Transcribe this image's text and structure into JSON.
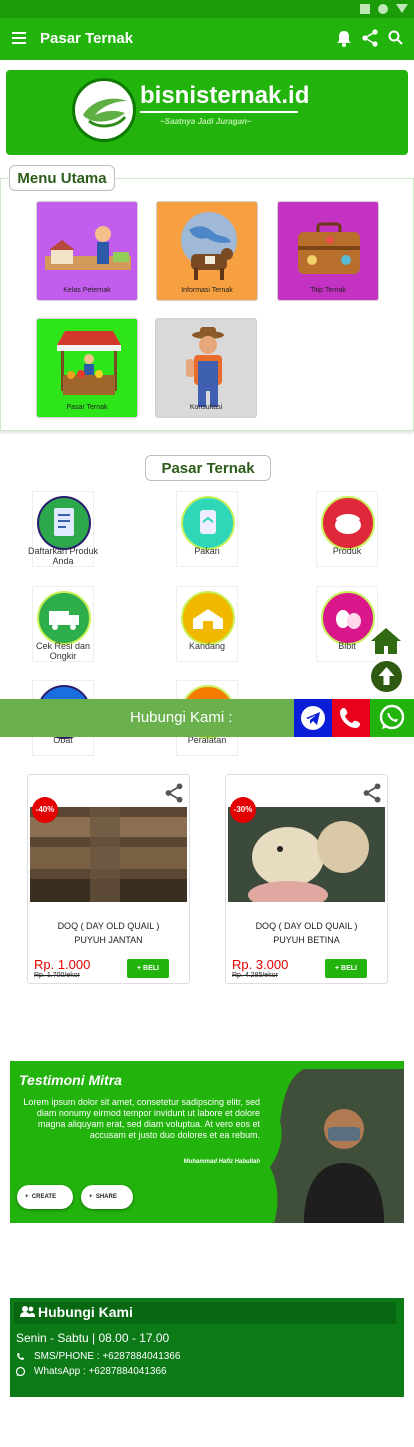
{
  "app": {
    "title": "Pasar Ternak"
  },
  "banner": {
    "brand": "bisnisternak.id",
    "tagline": "~Saatnya Jadi Juragan~"
  },
  "menu_utama": {
    "heading": "Menu Utama",
    "items": [
      {
        "label": "Kelas Peternak",
        "color": "#c35ded"
      },
      {
        "label": "Informasi Ternak",
        "color": "#f6a041"
      },
      {
        "label": "Titip Ternak",
        "color": "#c432c4"
      },
      {
        "label": "Pasar Ternak",
        "color": "#2ee51a"
      },
      {
        "label": "Konsultasi",
        "color": "#d9d9d9"
      }
    ]
  },
  "pasar_ternak": {
    "heading": "Pasar Ternak",
    "categories": [
      {
        "label": "Daftarkan Produk Anda",
        "color": "#2ea84d"
      },
      {
        "label": "Pakan",
        "color": "#2fd6b8"
      },
      {
        "label": "Produk",
        "color": "#e0283a"
      },
      {
        "label": "Cek Resi dan Ongkir",
        "color": "#2eae4a"
      },
      {
        "label": "Kandang",
        "color": "#f0b900"
      },
      {
        "label": "Bibit",
        "color": "#d9178a"
      },
      {
        "label": "Obat",
        "color": "#1a6fe0"
      },
      {
        "label": "Peralatan",
        "color": "#f57c00"
      }
    ]
  },
  "contact_bar": {
    "label": "Hubungi Kami :"
  },
  "products": [
    {
      "discount": "-40%",
      "name_line1": "DOQ ( DAY OLD QUAIL )",
      "name_line2": "PUYUH JANTAN",
      "price": "Rp. 1.000",
      "old_price": "Rp. 1.700/ekor",
      "buy_label": "BELI"
    },
    {
      "discount": "-30%",
      "name_line1": "DOQ ( DAY OLD QUAIL )",
      "name_line2": "PUYUH BETINA",
      "price": "Rp. 3.000",
      "old_price": "Rp. 4.285/ekor",
      "buy_label": "BELI"
    }
  ],
  "testimoni": {
    "heading": "Testimoni Mitra",
    "body": "Lorem ipsum dolor sit amet, consetetur sadipscing elitr, sed diam nonumy eirmod tempor invidunt ut labore et dolore magna aliquyam erat, sed diam voluptua. At vero eos et accusam et justo duo dolores et ea rebum.",
    "author": "Muhammad Hafiz Habullah",
    "create_label": "CREATE",
    "share_label": "SHARE"
  },
  "hubungi": {
    "heading": "Hubungi Kami",
    "hours": "Senin - Sabtu | 08.00 - 17.00",
    "phone": "SMS/PHONE : +6287884041366",
    "whatsapp": "WhatsApp : +6287884041366"
  },
  "colors": {
    "primary": "#22b30d",
    "dark_green": "#0d7a18",
    "discount_red": "#e40000",
    "telegram": "#0a1ed8",
    "phone": "#e8001c",
    "whatsapp": "#22b30d"
  }
}
